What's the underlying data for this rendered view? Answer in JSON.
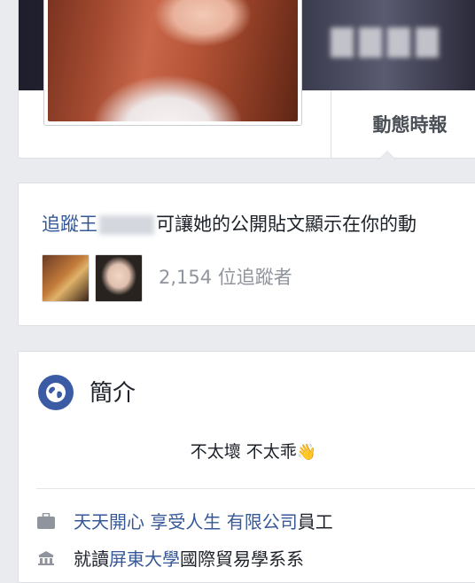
{
  "header": {
    "tab_timeline_label": "動態時報"
  },
  "follow": {
    "link_text": "追蹤王",
    "sentence": "可讓她的公開貼文顯示在你的動",
    "follower_count": "2,154 位追蹤者"
  },
  "about": {
    "title": "簡介",
    "bio": "不太壞 不太乖",
    "bio_emoji": "👋",
    "work_label": "天天開心 享受人生 有限公司",
    "work_suffix": "員工",
    "school_prefix": "就讀",
    "school_name": "屏東大學",
    "school_suffix": "國際貿易學系系"
  },
  "icons": {
    "globe": "globe-icon",
    "work": "briefcase-icon",
    "school": "school-icon"
  },
  "colors": {
    "link": "#365899",
    "globe_bg": "#3b5ba5",
    "page_bg": "#e9ebee"
  }
}
